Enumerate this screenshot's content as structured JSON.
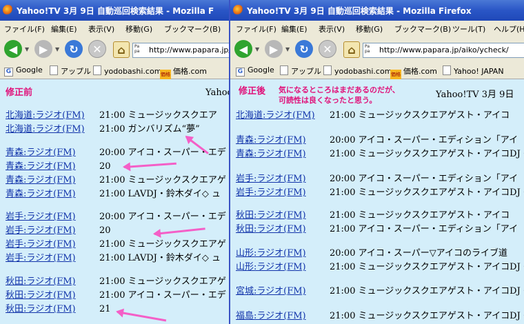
{
  "colors": {
    "link": "#1133aa",
    "annotation": "#e0127a",
    "arrow": "#f45fc7",
    "page_bg": "#d4eefa",
    "titlebar": "#2a56c6"
  },
  "left": {
    "title": "Yahoo!TV 3月 9日 自動巡回検索結果 - Mozilla F",
    "menus": [
      "ファイル(F)",
      "編集(E)",
      "表示(V)",
      "移動(G)",
      "ブックマーク(B)"
    ],
    "url": "http://www.papara.jp/ai",
    "bookmarks": [
      "Google",
      "アップル",
      "yodobashi.com",
      "価格.com"
    ],
    "tag": "修正前",
    "page_title": "Yahoo",
    "rows": [
      {
        "station": "北海道:ラジオ(FM)",
        "time": "21:00",
        "program": "ミュージックスクエア"
      },
      {
        "station": "北海道:ラジオ(FM)",
        "time": "21:00",
        "program": "ガンバリズム“夢”"
      },
      {
        "station": "青森:ラジオ(FM)",
        "time": "20:00",
        "program": "アイコ・スーパー・エデ"
      },
      {
        "station": "青森:ラジオ(FM)",
        "time": "20",
        "program": ""
      },
      {
        "station": "青森:ラジオ(FM)",
        "time": "21:00",
        "program": "ミュージックスクエアゲ"
      },
      {
        "station": "青森:ラジオ(FM)",
        "time": "21:00",
        "program": "LAVDJ・鈴木ダイ◇ ュ"
      },
      {
        "station": "岩手:ラジオ(FM)",
        "time": "20:00",
        "program": "アイコ・スーパー・エデ"
      },
      {
        "station": "岩手:ラジオ(FM)",
        "time": "20",
        "program": ""
      },
      {
        "station": "岩手:ラジオ(FM)",
        "time": "21:00",
        "program": "ミュージックスクエアゲ"
      },
      {
        "station": "岩手:ラジオ(FM)",
        "time": "21:00",
        "program": "LAVDJ・鈴木ダイ◇ ュ"
      },
      {
        "station": "秋田:ラジオ(FM)",
        "time": "21:00",
        "program": "ミュージックスクエアゲ"
      },
      {
        "station": "秋田:ラジオ(FM)",
        "time": "21:00",
        "program": "アイコ・スーパー・エデ"
      },
      {
        "station": "秋田:ラジオ(FM)",
        "time": "21",
        "program": ""
      }
    ]
  },
  "right": {
    "title": "Yahoo!TV 3月 9日 自動巡回検索結果 - Mozilla Firefox",
    "menus": [
      "ファイル(F)",
      "編集(E)",
      "表示(V)",
      "移動(G)",
      "ブックマーク(B)",
      "ツール(T)",
      "ヘルプ(H)"
    ],
    "url": "http://www.papara.jp/aiko/ycheck/",
    "bookmarks": [
      "Google",
      "アップル",
      "yodobashi.com",
      "価格.com",
      "Yahoo! JAPAN"
    ],
    "tag": "修正後",
    "note_line1": "気になるところはまだあるのだが、",
    "note_line2": "可読性は良くなったと思う。",
    "page_title": "Yahoo!TV 3月 9日",
    "rows": [
      {
        "station": "北海道:ラジオ(FM)",
        "time": "21:00",
        "program": "ミュージックスクエアゲスト・アイコ"
      },
      {
        "station": "青森:ラジオ(FM)",
        "time": "20:00",
        "program": "アイコ・スーパー・エディション「アイ"
      },
      {
        "station": "青森:ラジオ(FM)",
        "time": "21:00",
        "program": "ミュージックスクエアゲスト・アイコDJ・"
      },
      {
        "station": "岩手:ラジオ(FM)",
        "time": "20:00",
        "program": "アイコ・スーパー・エディション「アイ"
      },
      {
        "station": "岩手:ラジオ(FM)",
        "time": "21:00",
        "program": "ミュージックスクエアゲスト・アイコDJ・"
      },
      {
        "station": "秋田:ラジオ(FM)",
        "time": "21:00",
        "program": "ミュージックスクエアゲスト・アイコ"
      },
      {
        "station": "秋田:ラジオ(FM)",
        "time": "21:00",
        "program": "アイコ・スーパー・エディション「アイ"
      },
      {
        "station": "山形:ラジオ(FM)",
        "time": "20:00",
        "program": "アイコ・スーパー▽アイコのライブ道"
      },
      {
        "station": "山形:ラジオ(FM)",
        "time": "21:00",
        "program": "ミュージックスクエアゲスト・アイコDJ・"
      },
      {
        "station": "宮城:ラジオ(FM)",
        "time": "21:00",
        "program": "ミュージックスクエアゲスト・アイコDJ・"
      },
      {
        "station": "福島:ラジオ(FM)",
        "time": "21:00",
        "program": "ミュージックスクエアゲスト・アイコDJ・"
      }
    ]
  }
}
